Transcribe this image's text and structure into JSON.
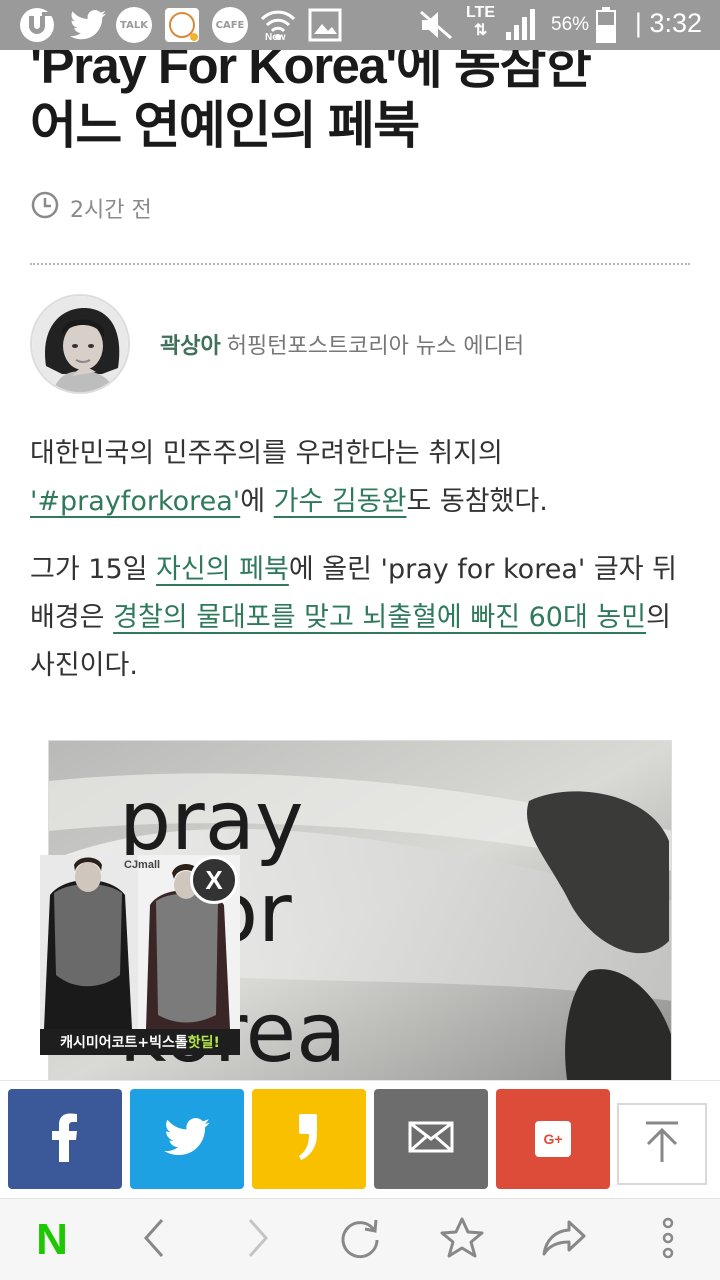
{
  "status_bar": {
    "time": "3:32",
    "battery": "56%",
    "network": "LTE",
    "icons": [
      "u-plus-icon",
      "twitter-icon",
      "kakaotalk-icon",
      "app-icon",
      "kakao-cafe-icon",
      "wifi-new-icon",
      "gallery-icon",
      "mute-icon",
      "signal-icon",
      "battery-icon"
    ],
    "talk": "TALK",
    "cafe": "CAFE",
    "new": "New"
  },
  "article": {
    "headline_lines": [
      "'Pray For Korea'에 동참한",
      "어느 연예인의 페북"
    ],
    "time_ago": "2시간 전",
    "author": {
      "name": "곽상아",
      "role": "허핑턴포스트코리아 뉴스 에디터"
    },
    "paragraph1": {
      "t1": "대한민국의 민주주의를 우려한다는 취지의",
      "link1": "'#prayforkorea'",
      "t2": "에 ",
      "link2": "가수 김동완",
      "t3": "도 동참했다."
    },
    "paragraph2": {
      "t1": "그가 15일 ",
      "link1": "자신의 페북",
      "t2": "에 올린 'pray for korea' 글자 뒤 배경은 ",
      "link2": "경찰의 물대포를 맞고 뇌출혈에 빠진 60대 농민",
      "t3": "의 사진이다."
    },
    "image_text": [
      "pray",
      "for",
      "korea"
    ]
  },
  "ad": {
    "brand": "CJmall",
    "caption_main": "캐시미어코트+빅스톨",
    "caption_highlight": " 핫딜!",
    "close_label": "X"
  },
  "share_bar": {
    "buttons": [
      {
        "name": "facebook",
        "color": "#3b5998"
      },
      {
        "name": "twitter",
        "color": "#1da1e2"
      },
      {
        "name": "kakaostory",
        "color": "#f9c000"
      },
      {
        "name": "email",
        "color": "#6d6d6d"
      },
      {
        "name": "google-plus",
        "color": "#dd4b39"
      }
    ],
    "google_label": "G+"
  },
  "toolbar": {
    "home_label": "N",
    "items": [
      "naver-home",
      "back",
      "forward",
      "reload",
      "bookmark",
      "share",
      "more"
    ]
  }
}
